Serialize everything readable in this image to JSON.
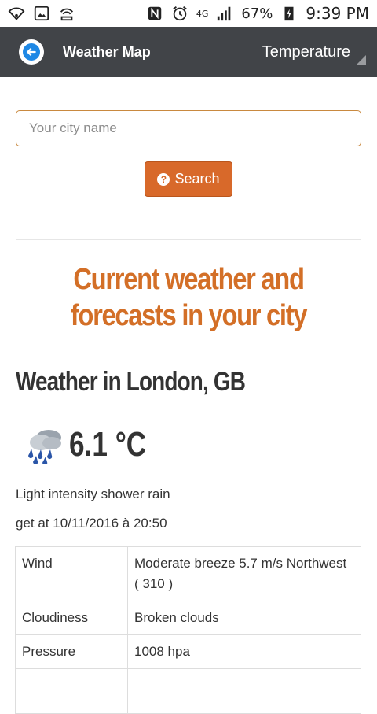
{
  "status_bar": {
    "battery": "67%",
    "time": "9:39 PM",
    "network": "4G"
  },
  "app_bar": {
    "title": "Weather Map",
    "spinner_value": "Temperature"
  },
  "search": {
    "placeholder": "Your city name",
    "button_label": "Search"
  },
  "headline": "Current weather and forecasts in your city",
  "weather": {
    "city_title": "Weather in London, GB",
    "temperature": "6.1 °C",
    "icon": "shower-rain-icon",
    "description": "Light intensity shower rain",
    "retrieved": "get at 10/11/2016 à 20:50"
  },
  "table": [
    {
      "key": "Wind",
      "value": "Moderate breeze 5.7 m/s Northwest ( 310 )"
    },
    {
      "key": "Cloudiness",
      "value": "Broken clouds"
    },
    {
      "key": "Pressure",
      "value": "1008 hpa"
    },
    {
      "key": "",
      "value": ""
    }
  ],
  "colors": {
    "accent": "#d36f27",
    "button": "#d8692a",
    "app_bar": "#414448"
  }
}
